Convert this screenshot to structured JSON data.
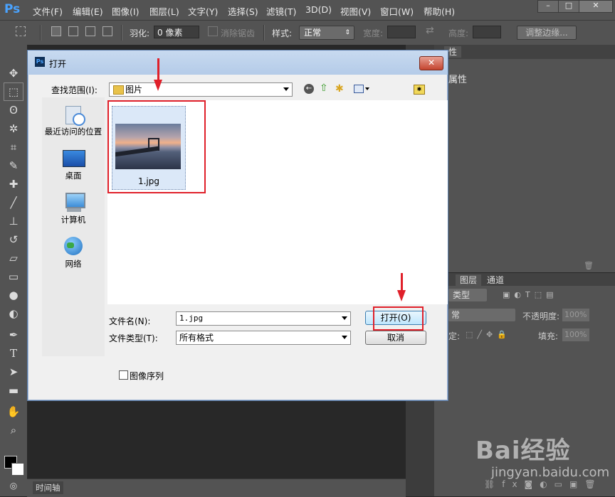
{
  "app": {
    "logo": "Ps"
  },
  "menu": [
    "文件(F)",
    "编辑(E)",
    "图像(I)",
    "图层(L)",
    "文字(Y)",
    "选择(S)",
    "滤镜(T)",
    "3D(D)",
    "视图(V)",
    "窗口(W)",
    "帮助(H)"
  ],
  "window_controls": {
    "minimize": "–",
    "maximize": "□",
    "close": "✕"
  },
  "options": {
    "feather_label": "羽化:",
    "feather_value": "0 像素",
    "antialias_label": "消除锯齿",
    "style_label": "样式:",
    "style_value": "正常",
    "width_label": "宽度:",
    "height_label": "高度:",
    "refine_edge": "调整边缘..."
  },
  "panels": {
    "properties_tab": "性",
    "properties_label": "属性",
    "layers_tab": "图层",
    "channels_tab": "通道",
    "kind_label": "类型",
    "blend_value": "常",
    "opacity_label": "不透明度:",
    "opacity_value": "100%",
    "lock_label": "定:",
    "fill_label": "填充:",
    "fill_value": "100%"
  },
  "timeline": {
    "tab": "时间轴"
  },
  "dialog": {
    "title": "打开",
    "lookin_label": "查找范围(I):",
    "lookin_value": "图片",
    "places": [
      {
        "label": "最近访问的位置",
        "icon": "recent-places-icon"
      },
      {
        "label": "桌面",
        "icon": "desktop-icon"
      },
      {
        "label": "计算机",
        "icon": "computer-icon"
      },
      {
        "label": "网络",
        "icon": "network-icon"
      }
    ],
    "file": {
      "name": "1.jpg",
      "icon": "image-thumbnail"
    },
    "filename_label": "文件名(N):",
    "filename_value": "1.jpg",
    "filetype_label": "文件类型(T):",
    "filetype_value": "所有格式",
    "open_button": "打开(O)",
    "cancel_button": "取消",
    "image_sequence_label": "图像序列"
  },
  "watermark": {
    "text": "Bai经验",
    "url": "jingyan.baidu.com"
  },
  "colors": {
    "annotation_red": "#e0202a",
    "ps_blue": "#4aa3ff"
  }
}
